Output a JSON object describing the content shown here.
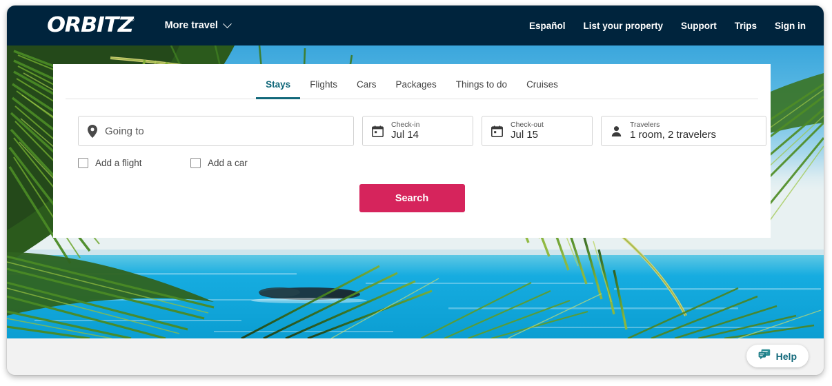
{
  "header": {
    "logo_text": "ORBITZ",
    "logo_mark": "®",
    "more_travel_label": "More travel",
    "nav": [
      {
        "label": "Español"
      },
      {
        "label": "List your property"
      },
      {
        "label": "Support"
      },
      {
        "label": "Trips"
      },
      {
        "label": "Sign in"
      }
    ]
  },
  "search_card": {
    "tabs": [
      {
        "label": "Stays",
        "active": true
      },
      {
        "label": "Flights",
        "active": false
      },
      {
        "label": "Cars",
        "active": false
      },
      {
        "label": "Packages",
        "active": false
      },
      {
        "label": "Things to do",
        "active": false
      },
      {
        "label": "Cruises",
        "active": false
      }
    ],
    "destination": {
      "icon": "map-pin-icon",
      "placeholder": "Going to",
      "value": ""
    },
    "checkin": {
      "icon": "calendar-icon",
      "label": "Check-in",
      "value": "Jul 14"
    },
    "checkout": {
      "icon": "calendar-icon",
      "label": "Check-out",
      "value": "Jul 15"
    },
    "travelers": {
      "icon": "person-icon",
      "label": "Travelers",
      "value": "1 room, 2 travelers"
    },
    "options": [
      {
        "label": "Add a flight",
        "checked": false
      },
      {
        "label": "Add a car",
        "checked": false
      }
    ],
    "search_button_label": "Search"
  },
  "footer": {
    "help_label": "Help",
    "help_icon": "chat-bubble-icon"
  },
  "colors": {
    "header_navy": "#00243d",
    "accent_teal": "#11687a",
    "search_crimson": "#d6245c",
    "footer_gray": "#f2f2f2"
  }
}
